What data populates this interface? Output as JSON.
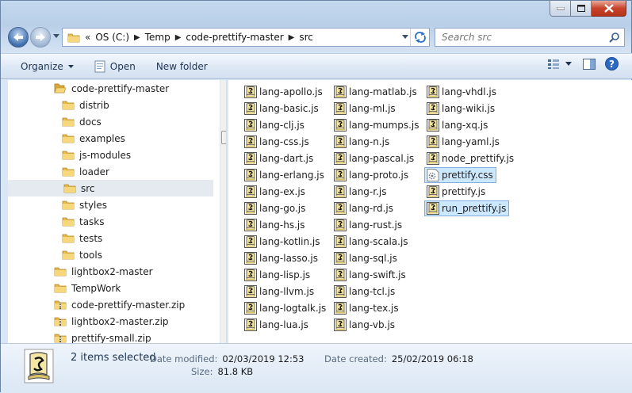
{
  "address": {
    "overflow": "«",
    "crumbs": [
      "OS (C:)",
      "Temp",
      "code-prettify-master",
      "src"
    ]
  },
  "search": {
    "placeholder": "Search src"
  },
  "toolbar": {
    "organize": "Organize",
    "open": "Open",
    "new_folder": "New folder"
  },
  "tree": [
    {
      "label": "code-prettify-master",
      "type": "folder-open",
      "indent": 1
    },
    {
      "label": "distrib",
      "type": "folder",
      "indent": 2
    },
    {
      "label": "docs",
      "type": "folder",
      "indent": 2
    },
    {
      "label": "examples",
      "type": "folder",
      "indent": 2
    },
    {
      "label": "js-modules",
      "type": "folder",
      "indent": 2
    },
    {
      "label": "loader",
      "type": "folder",
      "indent": 2
    },
    {
      "label": "src",
      "type": "folder",
      "indent": 2,
      "selected": true
    },
    {
      "label": "styles",
      "type": "folder",
      "indent": 2
    },
    {
      "label": "tasks",
      "type": "folder",
      "indent": 2
    },
    {
      "label": "tests",
      "type": "folder",
      "indent": 2
    },
    {
      "label": "tools",
      "type": "folder",
      "indent": 2
    },
    {
      "label": "lightbox2-master",
      "type": "folder",
      "indent": 1
    },
    {
      "label": "TempWork",
      "type": "folder",
      "indent": 1
    },
    {
      "label": "code-prettify-master.zip",
      "type": "zip",
      "indent": 1
    },
    {
      "label": "lightbox2-master.zip",
      "type": "zip",
      "indent": 1
    },
    {
      "label": "prettify-small.zip",
      "type": "zip",
      "indent": 1
    }
  ],
  "files": {
    "col1": [
      "lang-apollo.js",
      "lang-basic.js",
      "lang-clj.js",
      "lang-css.js",
      "lang-dart.js",
      "lang-erlang.js",
      "lang-ex.js",
      "lang-go.js",
      "lang-hs.js",
      "lang-kotlin.js",
      "lang-lasso.js",
      "lang-lisp.js",
      "lang-llvm.js",
      "lang-logtalk.js",
      "lang-lua.js"
    ],
    "col2": [
      "lang-matlab.js",
      "lang-ml.js",
      "lang-mumps.js",
      "lang-n.js",
      "lang-pascal.js",
      "lang-proto.js",
      "lang-r.js",
      "lang-rd.js",
      "lang-rust.js",
      "lang-scala.js",
      "lang-sql.js",
      "lang-swift.js",
      "lang-tcl.js",
      "lang-tex.js",
      "lang-vb.js"
    ],
    "col3": [
      {
        "name": "lang-vhdl.js",
        "type": "js"
      },
      {
        "name": "lang-wiki.js",
        "type": "js"
      },
      {
        "name": "lang-xq.js",
        "type": "js"
      },
      {
        "name": "lang-yaml.js",
        "type": "js"
      },
      {
        "name": "node_prettify.js",
        "type": "js"
      },
      {
        "name": "prettify.css",
        "type": "css",
        "selected": true
      },
      {
        "name": "prettify.js",
        "type": "js"
      },
      {
        "name": "run_prettify.js",
        "type": "js",
        "selected": true
      }
    ]
  },
  "details": {
    "selection": "2 items selected",
    "date_modified_label": "Date modified:",
    "date_modified": "02/03/2019 12:53",
    "date_created_label": "Date created:",
    "date_created": "25/02/2019 06:18",
    "size_label": "Size:",
    "size": "81.8 KB"
  }
}
